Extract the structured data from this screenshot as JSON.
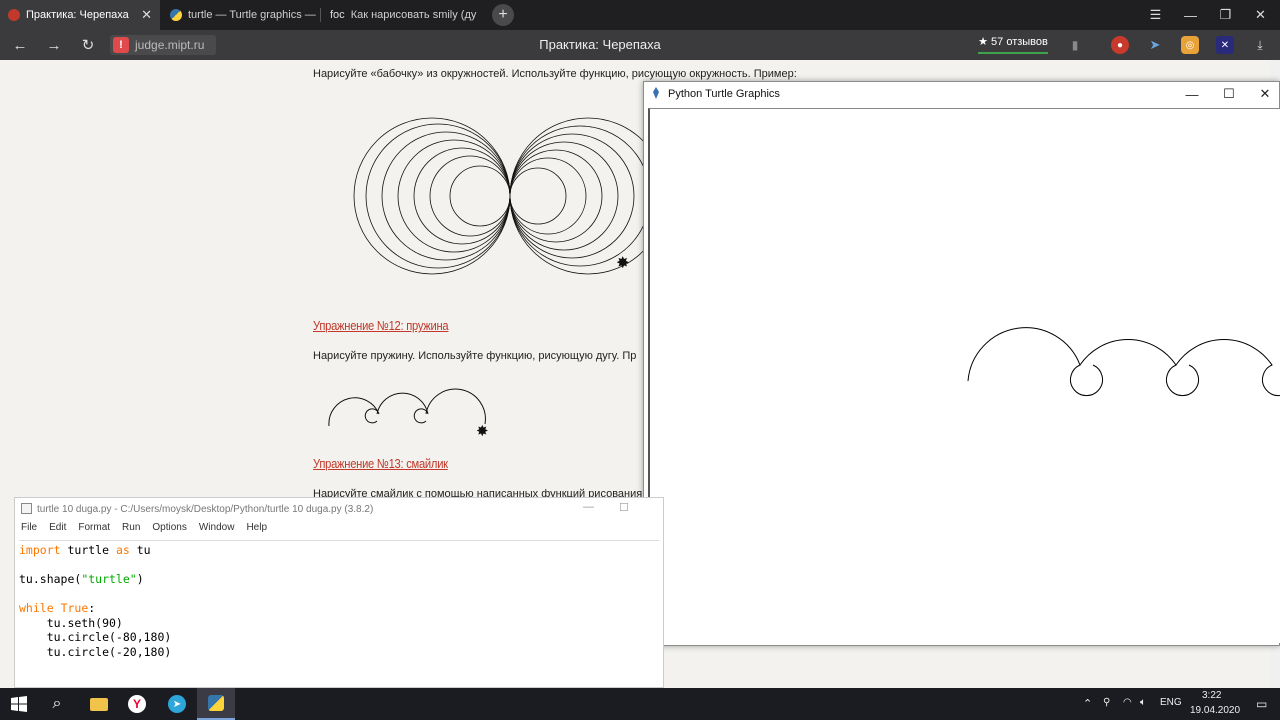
{
  "browser": {
    "tabs": [
      {
        "label": "Практика: Черепаха",
        "active": true
      },
      {
        "label": "turtle — Turtle graphics —",
        "active": false
      },
      {
        "label": "Как нарисовать smily (дуг",
        "prefix": "foc",
        "active": false
      }
    ],
    "url": "judge.mipt.ru",
    "page_title": "Практика: Черепаха",
    "reviews": "★ 57 отзывов"
  },
  "page": {
    "butterfly_text": "Нарисуйте «бабочку» из окружностей. Используйте функцию, рисующую окружность. Пример:",
    "ex12_heading": "Упражнение №12: пружина",
    "ex12_text": "Нарисуйте пружину. Используйте функцию, рисующую дугу. Пр",
    "ex13_heading": "Упражнение №13: смайлик",
    "ex13_text": "Нарисуйте смайлик с помощью написанных функций рисования"
  },
  "turtle_window": {
    "title": "Python Turtle Graphics"
  },
  "idle": {
    "title": "turtle 10 duga.py - C:/Users/moysk/Desktop/Python/turtle 10 duga.py (3.8.2)",
    "menu": [
      "File",
      "Edit",
      "Format",
      "Run",
      "Options",
      "Window",
      "Help"
    ],
    "code_lines": [
      [
        {
          "t": "import",
          "c": "kw"
        },
        {
          "t": " turtle ",
          "c": ""
        },
        {
          "t": "as",
          "c": "kw"
        },
        {
          "t": " tu",
          "c": ""
        }
      ],
      [],
      [
        {
          "t": "tu.shape(",
          "c": ""
        },
        {
          "t": "\"turtle\"",
          "c": "str"
        },
        {
          "t": ")",
          "c": ""
        }
      ],
      [],
      [
        {
          "t": "while",
          "c": "kw"
        },
        {
          "t": " ",
          "c": ""
        },
        {
          "t": "True",
          "c": "kw"
        },
        {
          "t": ":",
          "c": ""
        }
      ],
      [
        {
          "t": "    tu.seth(90)",
          "c": ""
        }
      ],
      [
        {
          "t": "    tu.circle(-80,180)",
          "c": ""
        }
      ],
      [
        {
          "t": "    tu.circle(-20,180)",
          "c": ""
        }
      ]
    ]
  },
  "taskbar": {
    "lang": "ENG",
    "time": "3:22",
    "date": "19.04.2020"
  }
}
